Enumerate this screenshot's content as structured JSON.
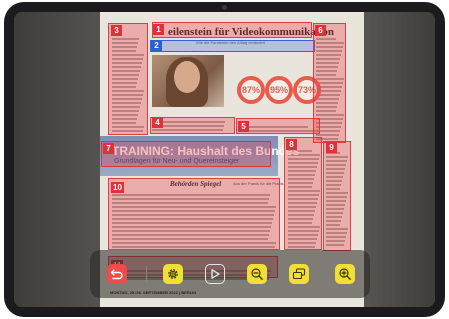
{
  "document": {
    "headline": "eilenstein für Videokommunikation",
    "subheadline": "Wie die Pandemie den Alltag verändert",
    "stats": [
      "87%",
      "95%",
      "73%"
    ],
    "banner_title": "TRAINING: Haushalt des Bundes",
    "banner_subtitle": "Grundlagen für Neu- und Quereinsteiger",
    "masthead": "Behörden Spiegel",
    "masthead_small": "Aus der Praxis für die Praxis",
    "bottom_line": "MONTAG, 25./26. SEPTEMBER 2022 | BERLIN"
  },
  "regions": [
    {
      "label": "1",
      "color": "red"
    },
    {
      "label": "2",
      "color": "blue"
    },
    {
      "label": "3",
      "color": "red"
    },
    {
      "label": "4",
      "color": "red"
    },
    {
      "label": "5",
      "color": "red"
    },
    {
      "label": "6",
      "color": "red"
    },
    {
      "label": "7",
      "color": "red"
    },
    {
      "label": "8",
      "color": "red"
    },
    {
      "label": "9",
      "color": "red"
    },
    {
      "label": "10",
      "color": "red"
    },
    {
      "label": "11",
      "color": "red"
    }
  ],
  "toolbar": {
    "buttons": [
      {
        "icon": "undo-icon",
        "color": "#f04a4a"
      },
      {
        "icon": "gear-icon",
        "color": "#f2df33"
      },
      {
        "icon": "play-icon",
        "color": "outline"
      },
      {
        "icon": "zoom-out-icon",
        "color": "#f2df33"
      },
      {
        "icon": "copy-icon",
        "color": "#f2df33"
      },
      {
        "icon": "zoom-in-icon",
        "color": "#f2df33"
      }
    ]
  },
  "colors": {
    "region_red": "#e0303b",
    "region_blue": "#2f5fd6",
    "bezel": "#1b1b1d"
  }
}
